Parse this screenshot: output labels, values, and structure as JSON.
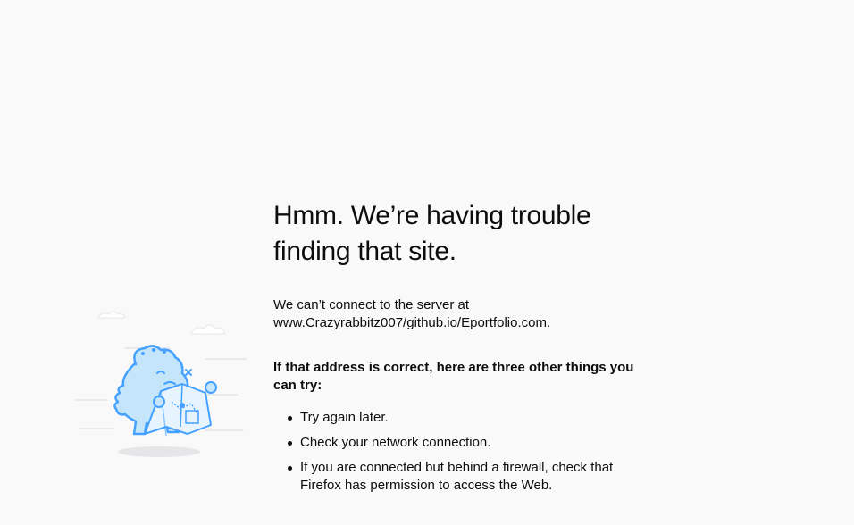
{
  "error_page": {
    "title": "Hmm. We’re having trouble finding that site.",
    "description_line1": "We can’t connect to the server at",
    "description_line2": "www.Crazyrabbitz007/github.io/Eportfolio.com.",
    "suggestions_heading": "If that address is correct, here are three other things you can try:",
    "suggestions": [
      "Try again later.",
      "Check your network connection.",
      "If you are connected but behind a firewall, check that Firefox has permission to access the Web."
    ]
  },
  "illustration": {
    "icon": "lost-map-dinosaur-icon",
    "accent_color": "#45a1ff",
    "fill_color": "#c4e5fa"
  },
  "colors": {
    "background": "#f9f9fa",
    "text": "#0c0c0d"
  }
}
